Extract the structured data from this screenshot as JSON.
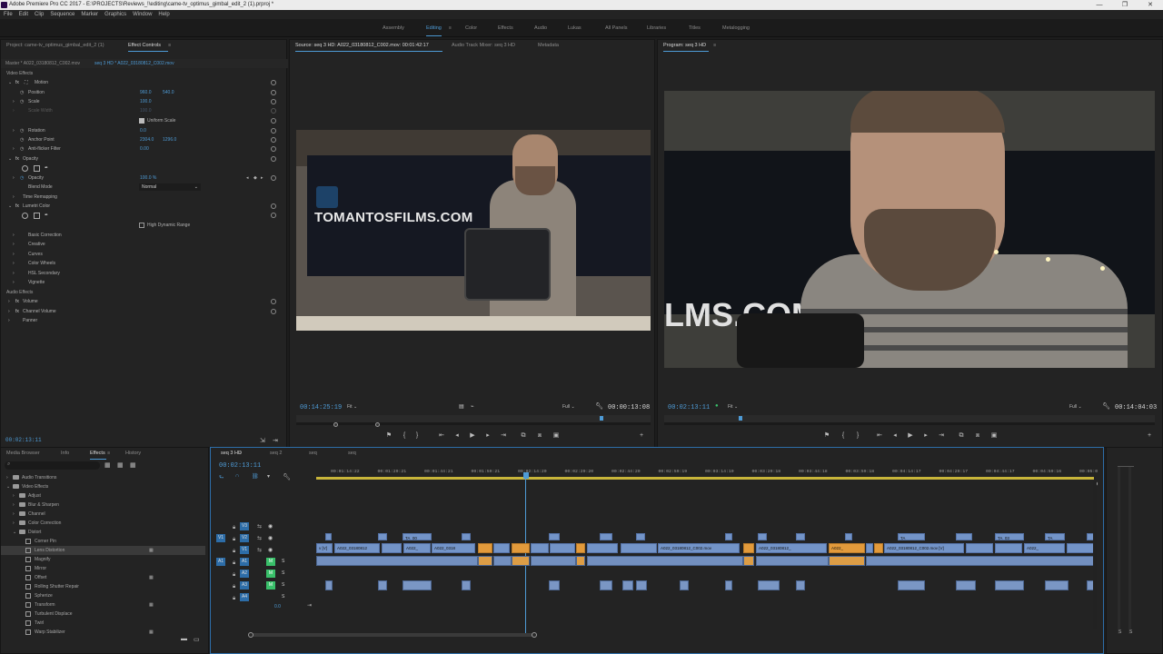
{
  "window": {
    "title": "Adobe Premiere Pro CC 2017 - E:\\PROJECTS\\Reviews_!\\editing\\came-tv_optimus_gimbal_edit_2 (1).prproj *",
    "min": "—",
    "max": "❐",
    "close": "✕"
  },
  "menu": [
    "File",
    "Edit",
    "Clip",
    "Sequence",
    "Marker",
    "Graphics",
    "Window",
    "Help"
  ],
  "workspaces": [
    "Assembly",
    "Editing",
    "Color",
    "Effects",
    "Audio",
    "Lukas",
    "All Panels",
    "Libraries",
    "Titles",
    "Metalogging"
  ],
  "workspace_active": "Editing",
  "effect_controls": {
    "tab_project": "Project: came-tv_optimus_gimbal_edit_2 (1)",
    "tab_active": "Effect Controls",
    "master": "Master * A022_03180812_C002.mov",
    "seq": "seq 3 HD * A022_03180812_C002.mov",
    "video_effects": "Video Effects",
    "motion": "Motion",
    "position": "Position",
    "position_x": "960.0",
    "position_y": "540.0",
    "scale": "Scale",
    "scale_val": "100.0",
    "scale_width": "Scale Width",
    "scale_width_val": "100.0",
    "uniform_scale": "Uniform Scale",
    "rotation": "Rotation",
    "rotation_val": "0.0",
    "anchor": "Anchor Point",
    "anchor_x": "2304.0",
    "anchor_y": "1296.0",
    "antiflicker": "Anti-flicker Filter",
    "antiflicker_val": "0.00",
    "opacity_group": "Opacity",
    "opacity": "Opacity",
    "opacity_val": "100.0 %",
    "blend_mode": "Blend Mode",
    "blend_val": "Normal",
    "time_remap": "Time Remapping",
    "lumetri": "Lumetri Color",
    "hdr": "High Dynamic Range",
    "basic": "Basic Correction",
    "creative": "Creative",
    "curves": "Curves",
    "color_wheels": "Color Wheels",
    "hsl": "HSL Secondary",
    "vignette": "Vignette",
    "audio_effects": "Audio Effects",
    "volume": "Volume",
    "channel_volume": "Channel Volume",
    "panner": "Panner",
    "timecode": "00:02:13:11"
  },
  "source_monitor": {
    "tab_active": "Source: seq 3 HD: A022_03180812_C002.mov: 00:01:42:17",
    "tab_mixer": "Audio Track Mixer: seq 3 HD",
    "tab_meta": "Metadata",
    "tc_in": "00:14:25:19",
    "fit": "Fit",
    "full": "Full",
    "tc_dur": "00:00:13:08",
    "brand_text": "TOMANTOSFILMS.COM"
  },
  "program_monitor": {
    "tab_active": "Program: seq 3 HD",
    "tc_in": "00:02:13:11",
    "fit": "Fit",
    "full": "Full",
    "tc_dur": "00:14:04:03",
    "brand_text": "LMS.COM"
  },
  "effects_panel": {
    "tabs": [
      "Media Browser",
      "Info",
      "Effects",
      "History"
    ],
    "active": "Effects",
    "items": [
      {
        "label": "Audio Transitions",
        "kind": "folder",
        "indent": 0
      },
      {
        "label": "Video Effects",
        "kind": "folder",
        "indent": 0
      },
      {
        "label": "Adjust",
        "kind": "folder",
        "indent": 1
      },
      {
        "label": "Blur & Sharpen",
        "kind": "folder",
        "indent": 1
      },
      {
        "label": "Channel",
        "kind": "folder",
        "indent": 1
      },
      {
        "label": "Color Correction",
        "kind": "folder",
        "indent": 1
      },
      {
        "label": "Distort",
        "kind": "folder",
        "indent": 1
      },
      {
        "label": "Corner Pin",
        "kind": "fx",
        "indent": 2
      },
      {
        "label": "Lens Distortion",
        "kind": "fx",
        "indent": 2
      },
      {
        "label": "Magnify",
        "kind": "fx",
        "indent": 2
      },
      {
        "label": "Mirror",
        "kind": "fx",
        "indent": 2
      },
      {
        "label": "Offset",
        "kind": "fx",
        "indent": 2
      },
      {
        "label": "Rolling Shutter Repair",
        "kind": "fx",
        "indent": 2
      },
      {
        "label": "Spherize",
        "kind": "fx",
        "indent": 2
      },
      {
        "label": "Transform",
        "kind": "fx",
        "indent": 2
      },
      {
        "label": "Turbulent Displace",
        "kind": "fx",
        "indent": 2
      },
      {
        "label": "Twirl",
        "kind": "fx",
        "indent": 2
      },
      {
        "label": "Warp Stabilizer",
        "kind": "fx",
        "indent": 2
      }
    ]
  },
  "timeline": {
    "tabs": [
      "seq 3 HD",
      "seq 2",
      "seq",
      "seq"
    ],
    "active": "seq 3 HD",
    "timecode": "00:02:13:11",
    "ruler": [
      "00:01:14:22",
      "00:01:29:21",
      "00:01:44:21",
      "00:01:59:21",
      "00:02:14:20",
      "00:02:29:20",
      "00:02:44:20",
      "00:02:59:19",
      "00:03:14:19",
      "00:03:29:18",
      "00:03:44:18",
      "00:03:59:18",
      "00:04:14:17",
      "00:04:29:17",
      "00:04:44:17",
      "00:04:59:16",
      "00:05:0"
    ],
    "tracks": [
      "V3",
      "V2",
      "V1",
      "A1",
      "A2",
      "A3",
      "A4"
    ],
    "src_v": "V1",
    "src_a": "A1",
    "master_vol": "0.0",
    "clip_labels": {
      "c1": "A022_03180812",
      "c2": "A022_",
      "c3": "A022_0318",
      "c4": "A022_03180812_C002.mov",
      "c5": "A022_03180812_",
      "c6": "A022_",
      "c7": "A022_03180812_C002.mov [V]",
      "c8": "A022_",
      "ta1": "TA_00",
      "ta2": "TA_",
      "ta3": "TA_03",
      "ta4": "TA_"
    },
    "fx_label": "fx",
    "edge_label": "v [V]"
  },
  "meter_labels": [
    "S",
    "S"
  ]
}
